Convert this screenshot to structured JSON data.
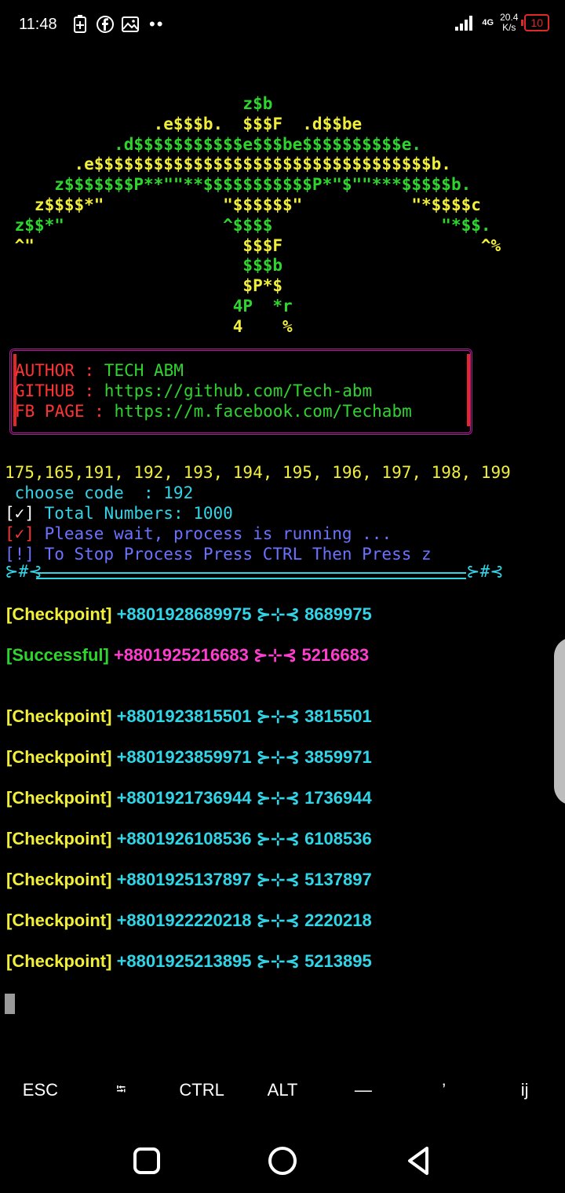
{
  "status_bar": {
    "time": "11:48",
    "speed_value": "20.4",
    "speed_unit": "K/s",
    "battery": "10",
    "network": "4G",
    "icons": [
      "battery-saver-icon",
      "facebook-icon",
      "gallery-icon",
      "more-dots-icon",
      "signal-icon",
      "network-4g-icon"
    ]
  },
  "ascii_art": [
    {
      "y": "",
      "g": "                        z$b"
    },
    {
      "y": "               .e$$$b.  $$$F  .d$$be"
    },
    {
      "g": "           .d$$$$$$$$$$$e$$$be$$$$$$$$$$e."
    },
    {
      "y": "       .e$$$$$$$$$$$$$$$$$$$$$$$$$$$$$$$$$$b."
    },
    {
      "g": "     z$$$$$$$P**\"\"**$$$$$$$$$$$P*\"$\"\"***$$$$$b."
    },
    {
      "y": "   z$$$$*\"            \"$$$$$$\"           \"*$$$$c"
    },
    {
      "g": " z$$*\"                ^$$$$                 \"*$$."
    },
    {
      "y": " ^\"                     $$$F                    ^%"
    },
    {
      "g": "                        $$$b"
    },
    {
      "y": "                        $P*$"
    },
    {
      "g": "                       4P  *r"
    },
    {
      "y": "                       4    %"
    }
  ],
  "info": {
    "author_label": "AUTHOR : ",
    "author_value": "TECH ABM",
    "github_label": "GITHUB : ",
    "github_value": "https://github.com/Tech-abm",
    "fb_label": "FB PAGE : ",
    "fb_value": "https://m.facebook.com/Techabm"
  },
  "codes_line": "175,165,191, 192, 193, 194, 195, 196, 197, 198, 199",
  "choose_prompt": " choose code  : 192",
  "total_mark": "[✓]",
  "total_text": " Total Numbers: 1000",
  "wait_mark": "[✓]",
  "wait_text": " Please wait, process is running ...",
  "stop_text": "[!] To Stop Process Press CTRL Then Press z",
  "separator_left": "⊱#⊰",
  "separator_right": "⊱#⊰",
  "results": [
    {
      "status": "[Checkpoint]",
      "number": "+8801928689975",
      "sep": "⊱⊹⊰",
      "code": "8689975",
      "color": "checkpoint"
    },
    {
      "status": "[Successful]",
      "number": "+8801925216683",
      "sep": "⊱⊹⊰",
      "code": "5216683",
      "color": "success"
    },
    {
      "status": "[Checkpoint]",
      "number": "+8801923815501",
      "sep": "⊱⊹⊰",
      "code": "3815501",
      "color": "checkpoint"
    },
    {
      "status": "[Checkpoint]",
      "number": "+8801923859971",
      "sep": "⊱⊹⊰",
      "code": "3859971",
      "color": "checkpoint"
    },
    {
      "status": "[Checkpoint]",
      "number": "+8801921736944",
      "sep": "⊱⊹⊰",
      "code": "1736944",
      "color": "checkpoint"
    },
    {
      "status": "[Checkpoint]",
      "number": "+8801926108536",
      "sep": "⊱⊹⊰",
      "code": "6108536",
      "color": "checkpoint"
    },
    {
      "status": "[Checkpoint]",
      "number": "+8801925137897",
      "sep": "⊱⊹⊰",
      "code": "5137897",
      "color": "checkpoint"
    },
    {
      "status": "[Checkpoint]",
      "number": "+8801922220218",
      "sep": "⊱⊹⊰",
      "code": "2220218",
      "color": "checkpoint"
    },
    {
      "status": "[Checkpoint]",
      "number": "+8801925213895",
      "sep": "⊱⊹⊰",
      "code": "5213895",
      "color": "checkpoint"
    }
  ],
  "extra_keys": [
    "ESC",
    "⭾",
    "CTRL",
    "ALT",
    "—",
    "’",
    "ij"
  ],
  "nav": [
    "recents-button",
    "home-button",
    "back-button"
  ],
  "colors": {
    "green": "#2fd52f",
    "yellow": "#f2ef3a",
    "cyan": "#30d6e8",
    "magenta": "#ff3ed0",
    "red": "#ff3333",
    "blue": "#6b72ff"
  }
}
